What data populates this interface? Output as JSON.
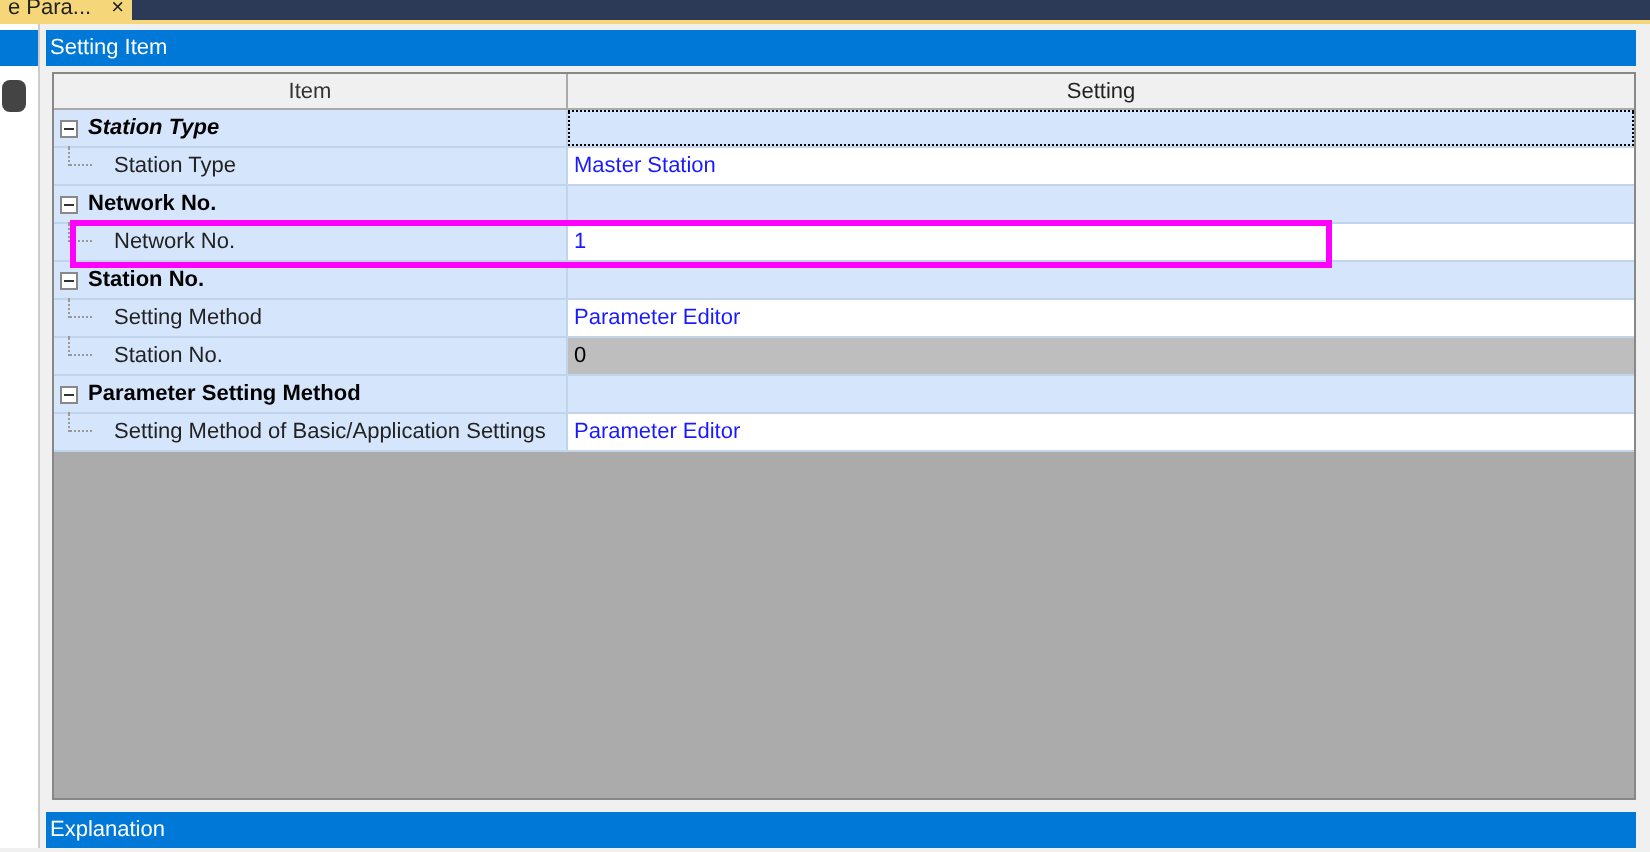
{
  "document_tab": {
    "label": "e Para...",
    "close": "×"
  },
  "setting_item": {
    "title": "Setting Item",
    "columns": [
      "Item",
      "Setting"
    ],
    "rows": [
      {
        "kind": "group",
        "label": "Station Type",
        "expanded": true,
        "italic": true,
        "focused": true
      },
      {
        "kind": "item",
        "label": "Station Type",
        "value": "Master Station",
        "disabled": false
      },
      {
        "kind": "group",
        "label": "Network No.",
        "expanded": true,
        "italic": false,
        "focused": false
      },
      {
        "kind": "item",
        "label": "Network No.",
        "value": "1",
        "disabled": false
      },
      {
        "kind": "group",
        "label": "Station No.",
        "expanded": true,
        "italic": false,
        "focused": false
      },
      {
        "kind": "item",
        "label": "Setting Method",
        "value": "Parameter Editor",
        "disabled": false
      },
      {
        "kind": "item",
        "label": "Station No.",
        "value": "0",
        "disabled": true
      },
      {
        "kind": "group",
        "label": "Parameter Setting Method",
        "expanded": true,
        "italic": false,
        "focused": false
      },
      {
        "kind": "item",
        "label": "Setting Method of Basic/Application Settings",
        "value": "Parameter Editor",
        "disabled": false
      }
    ]
  },
  "explanation": {
    "title": "Explanation"
  }
}
